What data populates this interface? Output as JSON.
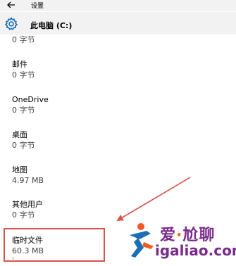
{
  "window": {
    "title": "设置",
    "back_icon": "back-arrow-icon"
  },
  "header": {
    "icon": "gear-icon",
    "title": "此电脑 (C:)"
  },
  "storage_items": [
    {
      "name": "",
      "size": "0 字节"
    },
    {
      "name": "邮件",
      "size": "0 字节"
    },
    {
      "name": "OneDrive",
      "size": "0 字节"
    },
    {
      "name": "桌面",
      "size": "0 字节"
    },
    {
      "name": "地图",
      "size": "4.97 MB"
    },
    {
      "name": "其他用户",
      "size": "0 字节"
    },
    {
      "name": "临时文件",
      "size": "60.3 MB"
    }
  ],
  "watermark": {
    "line1_a": "爱",
    "line1_dot": "·",
    "line1_b": "尬聊",
    "line2": "igaliao.com"
  },
  "colors": {
    "accent": "#1a6fb5",
    "highlight": "#d9534f",
    "watermark": "#7a2b8c"
  }
}
